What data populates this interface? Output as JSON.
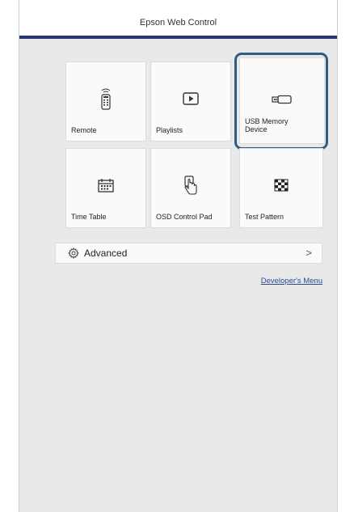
{
  "header": {
    "title": "Epson Web Control"
  },
  "tiles": [
    {
      "label": "Remote",
      "icon": "remote-icon"
    },
    {
      "label": "Playlists",
      "icon": "play-icon"
    },
    {
      "label": "USB Memory Device",
      "icon": "usb-icon",
      "selected": true
    },
    {
      "label": "Time Table",
      "icon": "calendar-icon"
    },
    {
      "label": "OSD Control Pad",
      "icon": "touch-icon"
    },
    {
      "label": "Test Pattern",
      "icon": "checkerboard-icon"
    }
  ],
  "advanced": {
    "label": "Advanced",
    "icon": "gear-icon",
    "chevron": ">"
  },
  "links": {
    "developer_menu": "Developer's Menu"
  },
  "colors": {
    "header_rule": "#2a3473",
    "selection_ring": "#2f5d87",
    "background": "#e9e9e9",
    "link": "#2b4a8a"
  }
}
